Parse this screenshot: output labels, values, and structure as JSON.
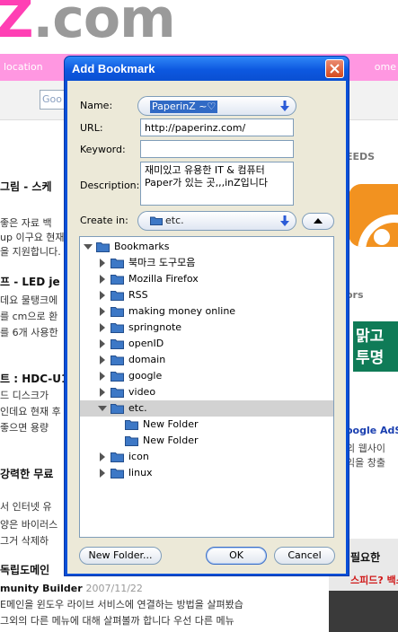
{
  "background": {
    "logo_z": "Z",
    "logo_rest": ".com",
    "nav_left": "location",
    "nav_right": "ome",
    "search_box": "Goo",
    "items": [
      {
        "text": "그림 - 스케",
        "kind": "title"
      },
      {
        "text": "좋은 자료 백",
        "kind": "text"
      },
      {
        "text": "up 이구요 현재",
        "kind": "text"
      },
      {
        "text": "을 지원합니다.",
        "kind": "text"
      },
      {
        "text": "프 - LED je",
        "kind": "title"
      },
      {
        "text": "데요 물탱크에",
        "kind": "text"
      },
      {
        "text": "를 cm으로 환",
        "kind": "text"
      },
      {
        "text": "를 6개 사용한",
        "kind": "text"
      },
      {
        "text": "트 : HDC-U1",
        "kind": "title"
      },
      {
        "text": "드 디스크가",
        "kind": "text"
      },
      {
        "text": "인데요 현재 후",
        "kind": "text"
      },
      {
        "text": "좋으면 용량",
        "kind": "text"
      },
      {
        "text": "강력한 무료",
        "kind": "title"
      },
      {
        "text": "서 인터넷 유",
        "kind": "text"
      },
      {
        "text": "양은 바이러스",
        "kind": "text"
      },
      {
        "text": "그거 삭제하",
        "kind": "text"
      },
      {
        "text": "독립도메인",
        "kind": "title"
      }
    ],
    "article": {
      "byline": "munity Builder",
      "date": "2007/11/22",
      "line1": "E메인을 윈도우 라이브 서비스에 연결하는 방법을 살펴봤습",
      "line2": "그외의 다른 메뉴에 대해 살펴볼까 합니다 우선 다른 메뉴"
    },
    "sidebar": {
      "feeds_head": "EEDS",
      "ors_head": "ors",
      "green_ad_1": "맑고",
      "green_ad_2": "투명",
      "adsense_title": "oogle AdSe",
      "adsense_1": "의 웹사이",
      "adsense_2": "익을 창출",
      "bottom_ad_1": "필요한",
      "bottom_ad_2": "스피드? 백스"
    }
  },
  "dialog": {
    "title": "Add Bookmark",
    "name_label": "Name:",
    "name_value": "PaperinZ ~♡",
    "url_label": "URL:",
    "url_value": "http://paperinz.com/",
    "keyword_label": "Keyword:",
    "keyword_value": "",
    "description_label": "Description:",
    "description_value": "재미있고 유용한 IT & 컴퓨터 Paper가 있는 곳,,,inZ입니다",
    "create_in_label": "Create in:",
    "create_in_value": "etc.",
    "tree": [
      {
        "label": "Bookmarks",
        "depth": 0,
        "twisty": "open"
      },
      {
        "label": "북마크 도구모음",
        "depth": 1,
        "twisty": "closed"
      },
      {
        "label": "Mozilla Firefox",
        "depth": 1,
        "twisty": "closed"
      },
      {
        "label": "RSS",
        "depth": 1,
        "twisty": "closed"
      },
      {
        "label": "making money online",
        "depth": 1,
        "twisty": "closed"
      },
      {
        "label": "springnote",
        "depth": 1,
        "twisty": "closed"
      },
      {
        "label": "openID",
        "depth": 1,
        "twisty": "closed"
      },
      {
        "label": "domain",
        "depth": 1,
        "twisty": "closed"
      },
      {
        "label": "google",
        "depth": 1,
        "twisty": "closed"
      },
      {
        "label": "video",
        "depth": 1,
        "twisty": "closed"
      },
      {
        "label": "etc.",
        "depth": 1,
        "twisty": "open",
        "selected": true
      },
      {
        "label": "New Folder",
        "depth": 2,
        "twisty": "none"
      },
      {
        "label": "New Folder",
        "depth": 2,
        "twisty": "none"
      },
      {
        "label": "icon",
        "depth": 1,
        "twisty": "closed"
      },
      {
        "label": "linux",
        "depth": 1,
        "twisty": "closed"
      }
    ],
    "new_folder_button": "New Folder...",
    "ok_button": "OK",
    "cancel_button": "Cancel"
  }
}
